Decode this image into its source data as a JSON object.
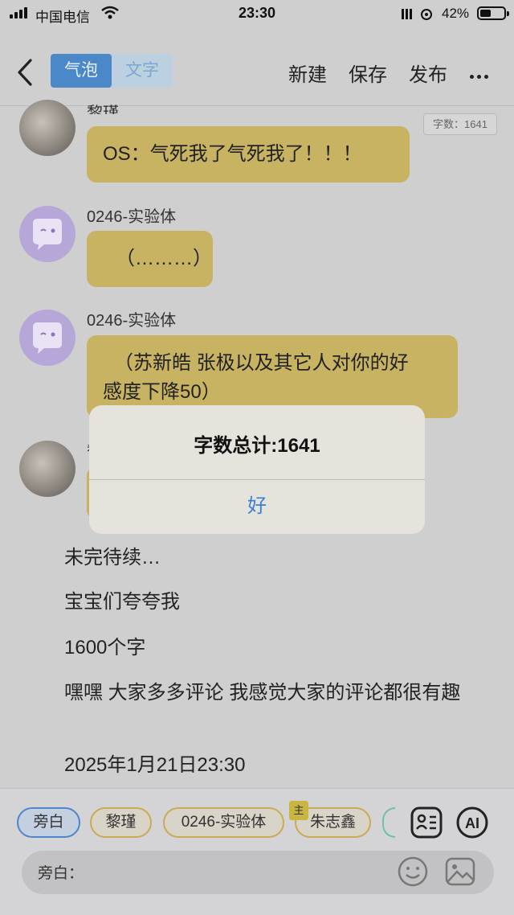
{
  "status_bar": {
    "carrier": "中国电信",
    "time": "23:30",
    "battery_pct": "42%"
  },
  "nav": {
    "tab_bubble": "气泡",
    "tab_text": "文字",
    "new": "新建",
    "save": "保存",
    "publish": "发布"
  },
  "word_count_tag": "字数：1641",
  "messages": [
    {
      "speaker": "黎瑾",
      "text": "OS：气死我了气死我了！！！"
    },
    {
      "speaker": "0246-实验体",
      "text": "（………）"
    },
    {
      "speaker": "0246-实验体",
      "line1": "（苏新皓 张极以及其它人对你的好",
      "line2": "感度下降50）"
    },
    {
      "speaker": "黎瑾"
    }
  ],
  "paragraphs": [
    "未完待续…",
    "宝宝们夸夸我",
    "1600个字",
    "嘿嘿 大家多多评论 我感觉大家的评论都很有趣",
    "2025年1月21日23:30"
  ],
  "alert": {
    "title": "字数总计:1641",
    "ok": "好"
  },
  "roles": {
    "narrator": "旁白",
    "role1": "黎瑾",
    "role2": "0246-实验体",
    "role3": "朱志鑫",
    "host_badge": "主"
  },
  "input": {
    "placeholder": "旁白："
  },
  "colors": {
    "bubble": "#c8b362",
    "accent": "#4a88c7",
    "chip_border": "#c9aa56"
  }
}
